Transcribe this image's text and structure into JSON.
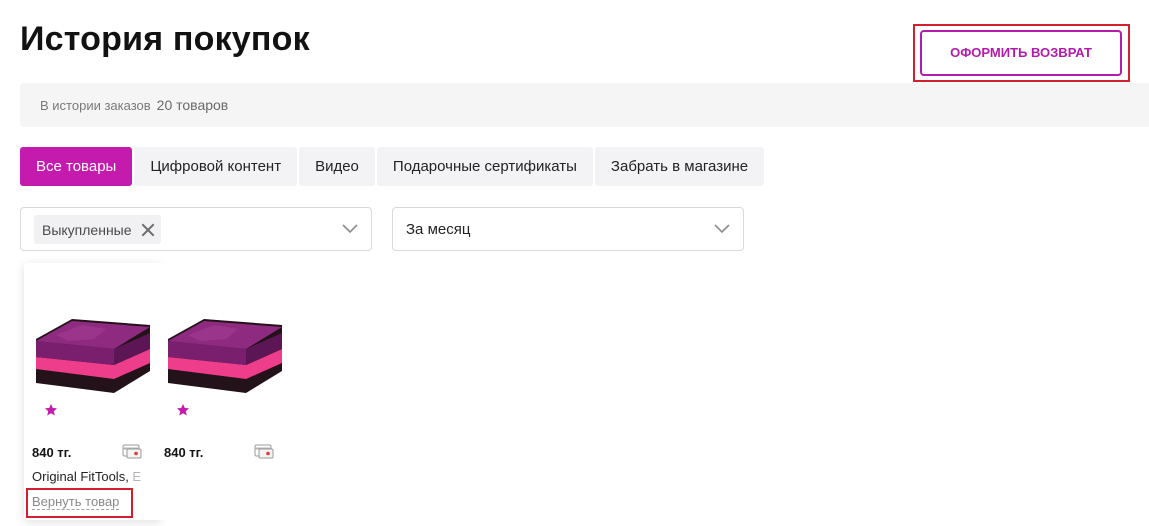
{
  "page": {
    "title": "История покупок"
  },
  "actions": {
    "return_button": "ОФОРМИТЬ ВОЗВРАТ"
  },
  "info": {
    "label": "В истории заказов",
    "count": "20 товаров"
  },
  "tabs": [
    {
      "label": "Все товары",
      "active": true
    },
    {
      "label": "Цифровой контент",
      "active": false
    },
    {
      "label": "Видео",
      "active": false
    },
    {
      "label": "Подарочные сертификаты",
      "active": false
    },
    {
      "label": "Забрать в магазине",
      "active": false
    }
  ],
  "filters": {
    "status": {
      "chip": "Выкупленные"
    },
    "period": {
      "value": "За месяц"
    }
  },
  "products": [
    {
      "price": "840 тг.",
      "name": "Original FitTools,",
      "name_fade": " E",
      "return_link": "Вернуть товар"
    },
    {
      "price": "840 тг."
    }
  ],
  "colors": {
    "accent": "#c41aad",
    "highlight": "#d32030",
    "product_purple": "#7a1f6e",
    "product_pink": "#ee3d8a",
    "product_dark": "#2a1a22"
  },
  "icons": [
    "close-icon",
    "chevron-down-icon",
    "star-icon",
    "payment-card-icon"
  ]
}
